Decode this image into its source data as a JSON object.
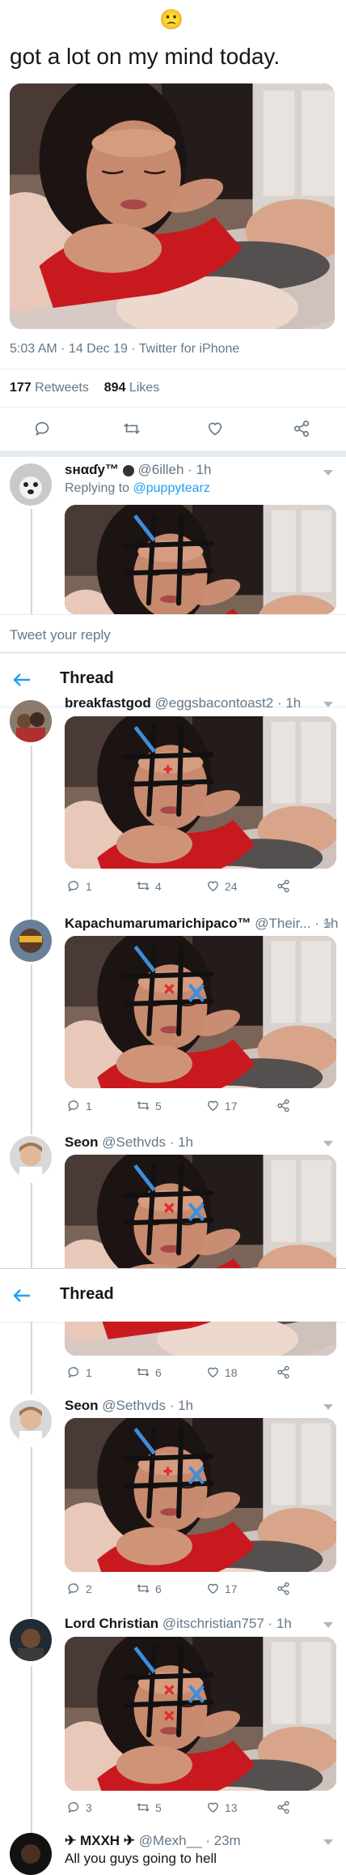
{
  "top_emoji": "🙁",
  "main_tweet": {
    "text": "got a lot on my mind today.",
    "meta": "5:03 AM · 14 Dec 19 · Twitter for iPhone",
    "retweets_count": "177",
    "retweets_label": "Retweets",
    "likes_count": "894",
    "likes_label": "Likes"
  },
  "reply_1": {
    "name": "ѕнαɗу™",
    "handle": "@6illeh · 1h",
    "replying_prefix": "Replying to ",
    "replying_to": "@puppytearz"
  },
  "composer": {
    "placeholder": "Tweet your reply"
  },
  "thread_title": "Thread",
  "tweets": [
    {
      "name": "breakfastgod",
      "handle": "@eggsbacontoast2 · 1h",
      "replies": "1",
      "retweets": "4",
      "likes": "24"
    },
    {
      "name": "Kapachumarumarichipaco™",
      "handle": "@Their... · 1h",
      "replies": "1",
      "retweets": "5",
      "likes": "17"
    },
    {
      "name": "Seon",
      "handle": "@Sethvds · 1h"
    },
    {
      "partial": true,
      "replies": "1",
      "retweets": "6",
      "likes": "18"
    },
    {
      "name": "Seon",
      "handle": "@Sethvds · 1h",
      "replies": "2",
      "retweets": "6",
      "likes": "17"
    },
    {
      "name": "Lord Christian",
      "handle": "@itschristian757 · 1h",
      "replies": "3",
      "retweets": "5",
      "likes": "13"
    },
    {
      "name": "✈ MXXH ✈",
      "handle": "@Mexh__ · 23m",
      "text": "All you guys going to hell"
    }
  ],
  "colors": {
    "accent": "#1da1f2",
    "muted": "#657786",
    "dress": "#c8191e",
    "pen": "#1a1a1a",
    "blue_mark": "#3b8fe0",
    "red_mark": "#e0302a"
  }
}
